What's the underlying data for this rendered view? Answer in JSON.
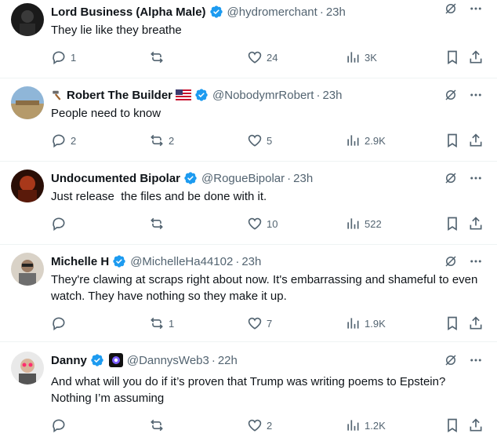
{
  "tweets": [
    {
      "name": "Lord Business (Alpha Male)",
      "handle": "@hydromerchant",
      "time": "23h",
      "text": "They lie like they breathe",
      "replies": "1",
      "reposts": "",
      "likes": "24",
      "views": "3K"
    },
    {
      "name": "Robert The Builder",
      "handle": "@NobodymrRobert",
      "time": "23h",
      "text": "People need to know",
      "replies": "2",
      "reposts": "2",
      "likes": "5",
      "views": "2.9K"
    },
    {
      "name": "Undocumented Bipolar",
      "handle": "@RogueBipolar",
      "time": "23h",
      "text": "Just release  the files and be done with it.",
      "replies": "",
      "reposts": "",
      "likes": "10",
      "views": "522"
    },
    {
      "name": "Michelle H",
      "handle": "@MichelleHa44102",
      "time": "23h",
      "text": "They're clawing at scraps right about now. It's embarrassing and shameful to even watch. They have nothing so they make it up.",
      "replies": "",
      "reposts": "1",
      "likes": "7",
      "views": "1.9K"
    },
    {
      "name": "Danny",
      "handle": "@DannysWeb3",
      "time": "22h",
      "text": "And what will you do if it’s proven that Trump was writing poems to Epstein? Nothing I’m assuming",
      "replies": "",
      "reposts": "",
      "likes": "2",
      "views": "1.2K"
    }
  ],
  "separator": "·",
  "colors": {
    "verified": "#1d9bf0",
    "muted": "#536471",
    "text": "#0f1419",
    "divider": "#eff3f4"
  },
  "icons": [
    "verified-badge-icon",
    "grok-icon",
    "more-icon",
    "reply-icon",
    "repost-icon",
    "like-icon",
    "views-icon",
    "bookmark-icon",
    "share-icon",
    "hammer-icon",
    "us-flag-icon",
    "eye-emoji-icon"
  ]
}
